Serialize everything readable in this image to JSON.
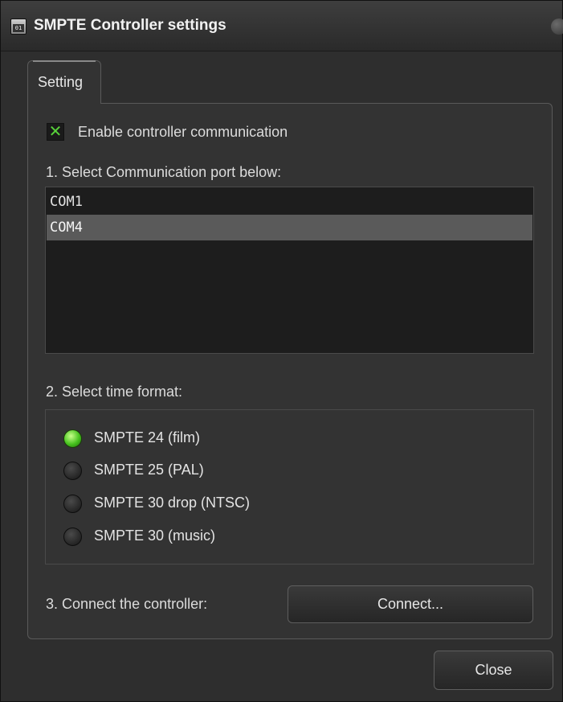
{
  "window": {
    "title": "SMPTE Controller settings",
    "icon": "clock-app-icon",
    "icon_text": "01"
  },
  "tabs": [
    {
      "label": "Setting",
      "active": true
    }
  ],
  "settings": {
    "enable_checkbox": {
      "label": "Enable controller communication",
      "checked": true
    },
    "port_section_label": "1. Select Communication port below:",
    "ports": [
      {
        "label": "COM1",
        "selected": false
      },
      {
        "label": "COM4",
        "selected": true
      }
    ],
    "time_format_label": "2. Select time format:",
    "time_formats": [
      {
        "label": "SMPTE 24 (film)",
        "selected": true
      },
      {
        "label": "SMPTE 25 (PAL)",
        "selected": false
      },
      {
        "label": "SMPTE 30 drop (NTSC)",
        "selected": false
      },
      {
        "label": "SMPTE 30 (music)",
        "selected": false
      }
    ],
    "connect_label": "3. Connect the controller:",
    "connect_button": "Connect..."
  },
  "footer": {
    "close_button": "Close"
  },
  "colors": {
    "accent_green": "#46c21e",
    "selection": "#5a5a5a",
    "background": "#2e2e2e"
  }
}
